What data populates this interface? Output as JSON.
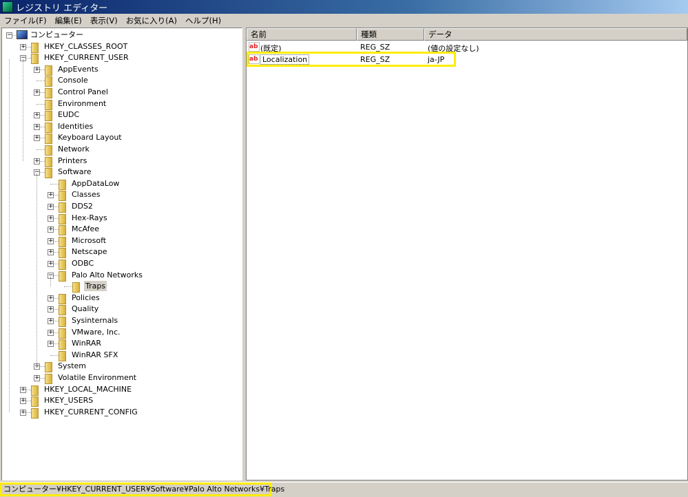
{
  "title": "レジストリ エディター",
  "menu": [
    "ファイル(F)",
    "編集(E)",
    "表示(V)",
    "お気に入り(A)",
    "ヘルプ(H)"
  ],
  "tree": [
    {
      "label": "コンピューター",
      "level": 0,
      "exp": "-",
      "icon": "computer"
    },
    {
      "label": "HKEY_CLASSES_ROOT",
      "level": 1,
      "exp": "+"
    },
    {
      "label": "HKEY_CURRENT_USER",
      "level": 1,
      "exp": "-"
    },
    {
      "label": "AppEvents",
      "level": 2,
      "exp": "+"
    },
    {
      "label": "Console",
      "level": 2,
      "exp": ""
    },
    {
      "label": "Control Panel",
      "level": 2,
      "exp": "+"
    },
    {
      "label": "Environment",
      "level": 2,
      "exp": ""
    },
    {
      "label": "EUDC",
      "level": 2,
      "exp": "+"
    },
    {
      "label": "Identities",
      "level": 2,
      "exp": "+"
    },
    {
      "label": "Keyboard Layout",
      "level": 2,
      "exp": "+"
    },
    {
      "label": "Network",
      "level": 2,
      "exp": ""
    },
    {
      "label": "Printers",
      "level": 2,
      "exp": "+"
    },
    {
      "label": "Software",
      "level": 2,
      "exp": "-"
    },
    {
      "label": "AppDataLow",
      "level": 3,
      "exp": ""
    },
    {
      "label": "Classes",
      "level": 3,
      "exp": "+"
    },
    {
      "label": "DDS2",
      "level": 3,
      "exp": "+"
    },
    {
      "label": "Hex-Rays",
      "level": 3,
      "exp": "+"
    },
    {
      "label": "McAfee",
      "level": 3,
      "exp": "+"
    },
    {
      "label": "Microsoft",
      "level": 3,
      "exp": "+"
    },
    {
      "label": "Netscape",
      "level": 3,
      "exp": "+"
    },
    {
      "label": "ODBC",
      "level": 3,
      "exp": "+"
    },
    {
      "label": "Palo Alto Networks",
      "level": 3,
      "exp": "-"
    },
    {
      "label": "Traps",
      "level": 4,
      "exp": "",
      "selected": true
    },
    {
      "label": "Policies",
      "level": 3,
      "exp": "+"
    },
    {
      "label": "Quality",
      "level": 3,
      "exp": "+"
    },
    {
      "label": "Sysinternals",
      "level": 3,
      "exp": "+"
    },
    {
      "label": "VMware, Inc.",
      "level": 3,
      "exp": "+"
    },
    {
      "label": "WinRAR",
      "level": 3,
      "exp": "+"
    },
    {
      "label": "WinRAR SFX",
      "level": 3,
      "exp": ""
    },
    {
      "label": "System",
      "level": 2,
      "exp": "+"
    },
    {
      "label": "Volatile Environment",
      "level": 2,
      "exp": "+"
    },
    {
      "label": "HKEY_LOCAL_MACHINE",
      "level": 1,
      "exp": "+"
    },
    {
      "label": "HKEY_USERS",
      "level": 1,
      "exp": "+"
    },
    {
      "label": "HKEY_CURRENT_CONFIG",
      "level": 1,
      "exp": "+"
    }
  ],
  "columns": [
    "名前",
    "種類",
    "データ"
  ],
  "values": [
    {
      "name": "(既定)",
      "type": "REG_SZ",
      "data": "(値の設定なし)",
      "icon": "ab"
    },
    {
      "name": "Localization",
      "type": "REG_SZ",
      "data": "ja-JP",
      "icon": "ab"
    }
  ],
  "status": "コンピューター¥HKEY_CURRENT_USER¥Software¥Palo Alto Networks¥Traps"
}
